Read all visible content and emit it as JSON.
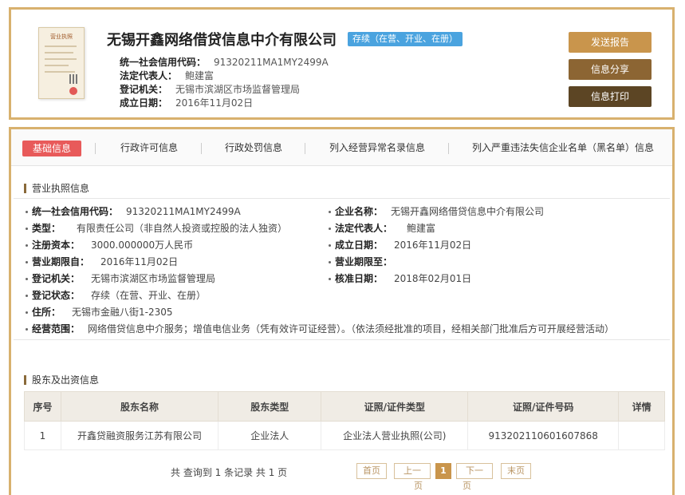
{
  "header": {
    "license_title": "营业执照",
    "company_name": "无锡开鑫网络借贷信息中介有限公司",
    "status_badge": "存续（在营、开业、在册）",
    "fields": [
      {
        "label": "统一社会信用代码：",
        "value": "91320211MA1MY2499A"
      },
      {
        "label": "法定代表人：",
        "value": "鲍建富"
      },
      {
        "label": "登记机关：",
        "value": "无锡市滨湖区市场监督管理局"
      },
      {
        "label": "成立日期：",
        "value": "2016年11月02日"
      }
    ],
    "buttons": {
      "send": "发送报告",
      "share": "信息分享",
      "print": "信息打印"
    }
  },
  "tabs": [
    "基础信息",
    "行政许可信息",
    "行政处罚信息",
    "列入经营异常名录信息",
    "列入严重违法失信企业名单（黑名单）信息"
  ],
  "license_section": {
    "title": "营业执照信息",
    "left": [
      {
        "label": "统一社会信用代码：",
        "value": "91320211MA1MY2499A"
      },
      {
        "label": "类型：",
        "value": "有限责任公司（非自然人投资或控股的法人独资）"
      },
      {
        "label": "注册资本：",
        "value": "3000.000000万人民币"
      },
      {
        "label": "营业期限自：",
        "value": "2016年11月02日"
      },
      {
        "label": "登记机关：",
        "value": "无锡市滨湖区市场监督管理局"
      },
      {
        "label": "登记状态：",
        "value": "存续（在营、开业、在册）"
      },
      {
        "label": "住所：",
        "value": "无锡市金融八街1-2305"
      },
      {
        "label": "经营范围：",
        "value": "网络借贷信息中介服务；增值电信业务（凭有效许可证经营）。（依法须经批准的项目，经相关部门批准后方可开展经营活动）"
      }
    ],
    "right": [
      {
        "label": "企业名称：",
        "value": "无锡开鑫网络借贷信息中介有限公司"
      },
      {
        "label": "法定代表人：",
        "value": "鲍建富"
      },
      {
        "label": "成立日期：",
        "value": "2016年11月02日"
      },
      {
        "label": "营业期限至：",
        "value": ""
      },
      {
        "label": "核准日期：",
        "value": "2018年02月01日"
      }
    ]
  },
  "shareholder_section": {
    "title": "股东及出资信息",
    "columns": [
      "序号",
      "股东名称",
      "股东类型",
      "证照/证件类型",
      "证照/证件号码",
      "详情"
    ],
    "rows": [
      [
        "1",
        "开鑫贷融资服务江苏有限公司",
        "企业法人",
        "企业法人营业执照(公司)",
        "91320211060160786​8",
        ""
      ]
    ]
  },
  "pager": {
    "summary": "共 查询到 1 条记录 共 1 页",
    "first": "首页",
    "prev": "上一",
    "prev_sub": "页",
    "current": "1",
    "next": "下一",
    "next_sub": "页",
    "last": "末页"
  },
  "colors": {
    "frame": "#d8b16e",
    "badge": "#4aa3df",
    "active_tab": "#e85a5a"
  }
}
